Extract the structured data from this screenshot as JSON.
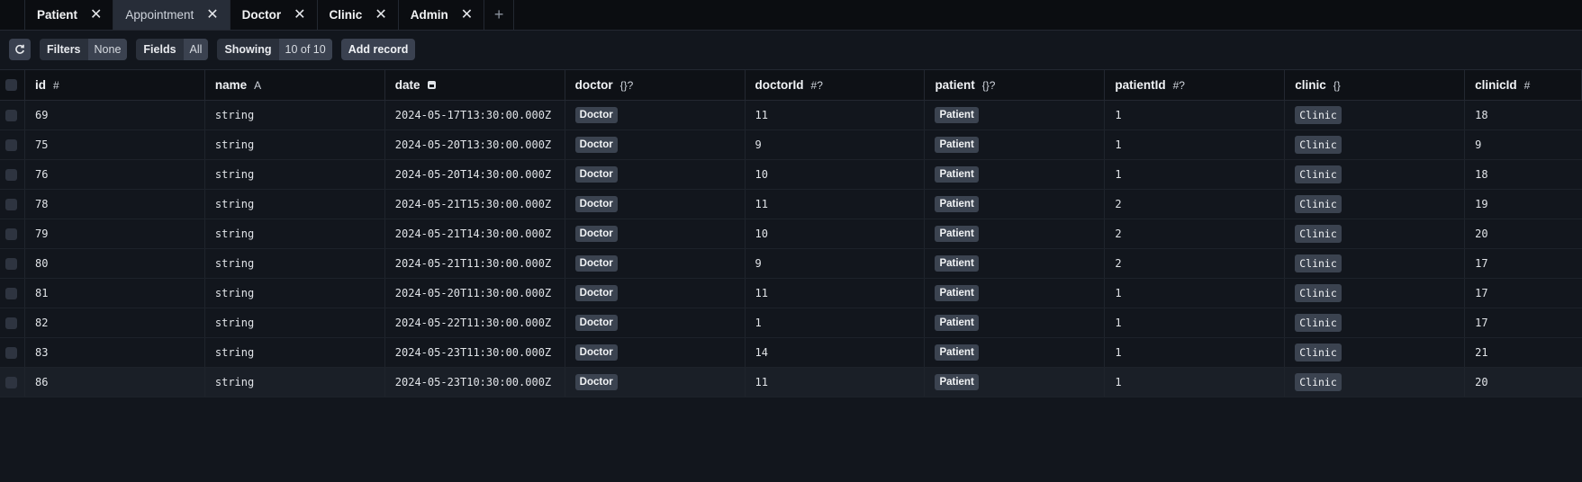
{
  "tabs": [
    {
      "label": "Patient",
      "active": false
    },
    {
      "label": "Appointment",
      "active": true
    },
    {
      "label": "Doctor",
      "active": false
    },
    {
      "label": "Clinic",
      "active": false
    },
    {
      "label": "Admin",
      "active": false
    }
  ],
  "tab_close_glyph": "✕",
  "tab_add_glyph": "+",
  "toolbar": {
    "filters_label": "Filters",
    "filters_value": "None",
    "fields_label": "Fields",
    "fields_value": "All",
    "showing_label": "Showing",
    "showing_value": "10 of 10",
    "add_record_label": "Add record"
  },
  "columns": [
    {
      "key": "id",
      "label": "id",
      "type_icon": "#"
    },
    {
      "key": "name",
      "label": "name",
      "type_icon": "A"
    },
    {
      "key": "date",
      "label": "date",
      "type_icon": "calendar-icon"
    },
    {
      "key": "doctor",
      "label": "doctor",
      "type_icon": "{}?"
    },
    {
      "key": "doctorId",
      "label": "doctorId",
      "type_icon": "#?"
    },
    {
      "key": "patient",
      "label": "patient",
      "type_icon": "{}?"
    },
    {
      "key": "patientId",
      "label": "patientId",
      "type_icon": "#?"
    },
    {
      "key": "clinic",
      "label": "clinic",
      "type_icon": "{}"
    },
    {
      "key": "clinicId",
      "label": "clinicId",
      "type_icon": "#"
    }
  ],
  "rows": [
    {
      "id": "69",
      "name": "string",
      "date": "2024-05-17T13:30:00.000Z",
      "doctor": "Doctor",
      "doctorId": "11",
      "patient": "Patient",
      "patientId": "1",
      "clinic": "Clinic",
      "clinicId": "18"
    },
    {
      "id": "75",
      "name": "string",
      "date": "2024-05-20T13:30:00.000Z",
      "doctor": "Doctor",
      "doctorId": "9",
      "patient": "Patient",
      "patientId": "1",
      "clinic": "Clinic",
      "clinicId": "9"
    },
    {
      "id": "76",
      "name": "string",
      "date": "2024-05-20T14:30:00.000Z",
      "doctor": "Doctor",
      "doctorId": "10",
      "patient": "Patient",
      "patientId": "1",
      "clinic": "Clinic",
      "clinicId": "18"
    },
    {
      "id": "78",
      "name": "string",
      "date": "2024-05-21T15:30:00.000Z",
      "doctor": "Doctor",
      "doctorId": "11",
      "patient": "Patient",
      "patientId": "2",
      "clinic": "Clinic",
      "clinicId": "19"
    },
    {
      "id": "79",
      "name": "string",
      "date": "2024-05-21T14:30:00.000Z",
      "doctor": "Doctor",
      "doctorId": "10",
      "patient": "Patient",
      "patientId": "2",
      "clinic": "Clinic",
      "clinicId": "20"
    },
    {
      "id": "80",
      "name": "string",
      "date": "2024-05-21T11:30:00.000Z",
      "doctor": "Doctor",
      "doctorId": "9",
      "patient": "Patient",
      "patientId": "2",
      "clinic": "Clinic",
      "clinicId": "17"
    },
    {
      "id": "81",
      "name": "string",
      "date": "2024-05-20T11:30:00.000Z",
      "doctor": "Doctor",
      "doctorId": "11",
      "patient": "Patient",
      "patientId": "1",
      "clinic": "Clinic",
      "clinicId": "17"
    },
    {
      "id": "82",
      "name": "string",
      "date": "2024-05-22T11:30:00.000Z",
      "doctor": "Doctor",
      "doctorId": "1",
      "patient": "Patient",
      "patientId": "1",
      "clinic": "Clinic",
      "clinicId": "17"
    },
    {
      "id": "83",
      "name": "string",
      "date": "2024-05-23T11:30:00.000Z",
      "doctor": "Doctor",
      "doctorId": "14",
      "patient": "Patient",
      "patientId": "1",
      "clinic": "Clinic",
      "clinicId": "21"
    },
    {
      "id": "86",
      "name": "string",
      "date": "2024-05-23T10:30:00.000Z",
      "doctor": "Doctor",
      "doctorId": "11",
      "patient": "Patient",
      "patientId": "1",
      "clinic": "Clinic",
      "clinicId": "20"
    }
  ],
  "highlighted_row_index": 9,
  "colors": {
    "background": "#12161d",
    "tab_active": "#272d38",
    "chip": "#3b4350"
  }
}
